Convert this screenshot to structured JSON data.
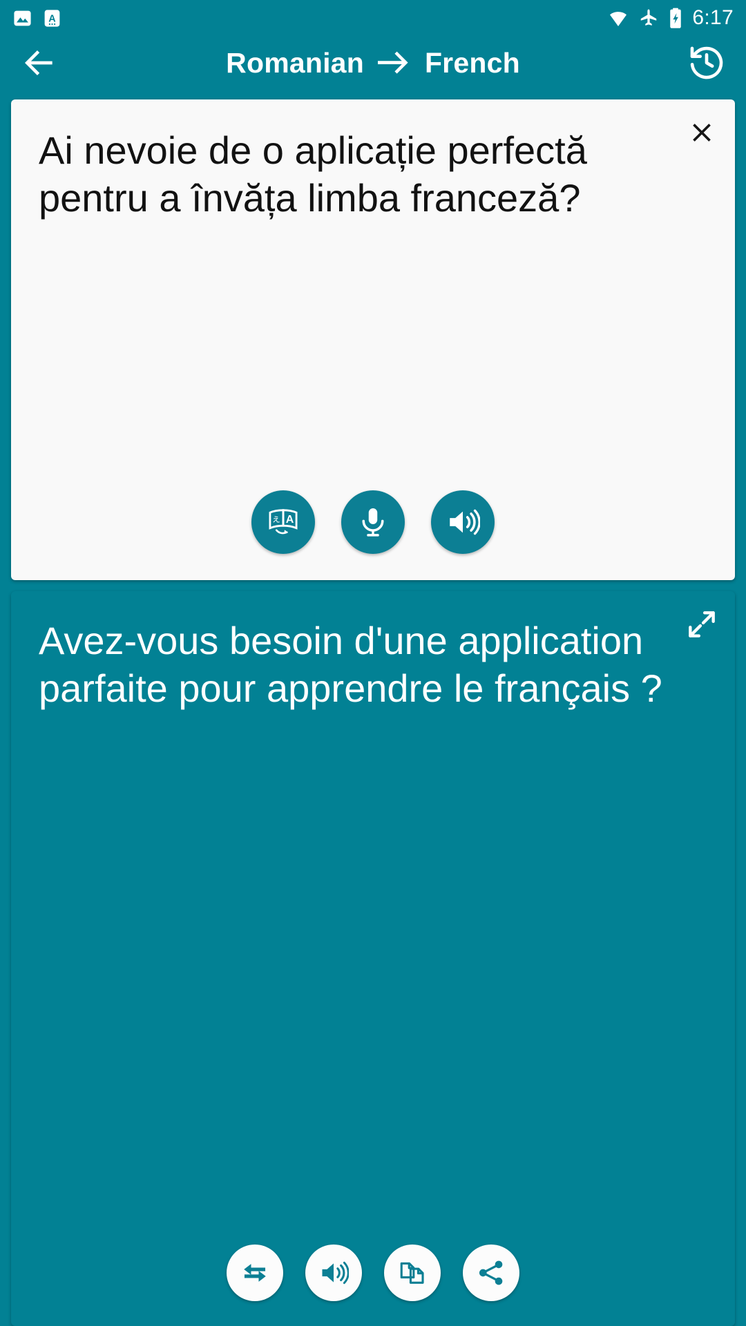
{
  "status_bar": {
    "time": "6:17",
    "notifications": [
      {
        "name": "image-notification-icon",
        "label": "image"
      },
      {
        "name": "text-notification-icon",
        "label": "A"
      }
    ],
    "indicators": [
      {
        "name": "wifi-icon",
        "label": "wifi"
      },
      {
        "name": "airplane-mode-icon",
        "label": "airplane mode"
      },
      {
        "name": "battery-charging-icon",
        "label": "battery charging"
      }
    ]
  },
  "app_bar": {
    "back_label": "Back",
    "source_language": "Romanian",
    "arrow": "→",
    "target_language": "French",
    "history_label": "History"
  },
  "source_card": {
    "text": "Ai nevoie de o aplicație perfectă pentru a învăța limba franceză?",
    "close_label": "✕",
    "actions": [
      {
        "name": "translate-button",
        "label": "Translate"
      },
      {
        "name": "microphone-button",
        "label": "Speak"
      },
      {
        "name": "speak-source-button",
        "label": "Listen"
      }
    ]
  },
  "target_card": {
    "text": "Avez-vous besoin d'une application parfaite pour apprendre le français ?",
    "expand_label": "Expand",
    "actions": [
      {
        "name": "swap-languages-button",
        "label": "Swap"
      },
      {
        "name": "speak-target-button",
        "label": "Listen"
      },
      {
        "name": "copy-button",
        "label": "Copy"
      },
      {
        "name": "share-button",
        "label": "Share"
      }
    ]
  },
  "colors": {
    "primary": "#028194",
    "fab_teal": "#0c7f94",
    "card_light": "#f9f9f9",
    "text_dark": "#121212",
    "text_light": "#ffffff"
  }
}
